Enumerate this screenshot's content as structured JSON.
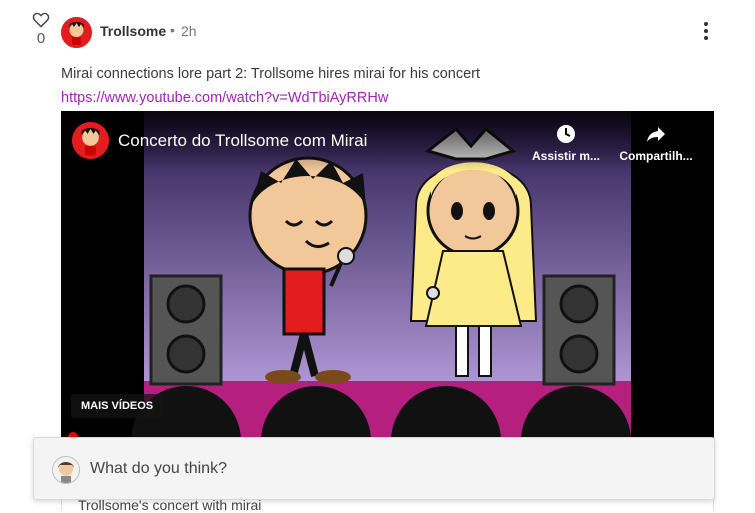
{
  "vote": {
    "count": "0",
    "icon": "heart-icon"
  },
  "post": {
    "author": "Trollsome",
    "separator": "•",
    "time": "2h",
    "text": "Mirai connections lore part 2: Trollsome hires mirai for his concert",
    "link": "https://www.youtube.com/watch?v=WdTbiAyRRHw"
  },
  "video": {
    "title": "Concerto do Trollsome com Mirai",
    "watch_later_label": "Assistir m...",
    "share_label": "Compartilh...",
    "more_videos_label": "MAIS VÍDEOS"
  },
  "comment": {
    "prompt": "What do you think?",
    "below_text": "Trollsome's concert with mirai"
  },
  "colors": {
    "link": "#9b27b0",
    "avatar_red": "#e31d1d",
    "stage": "#b5207e"
  }
}
